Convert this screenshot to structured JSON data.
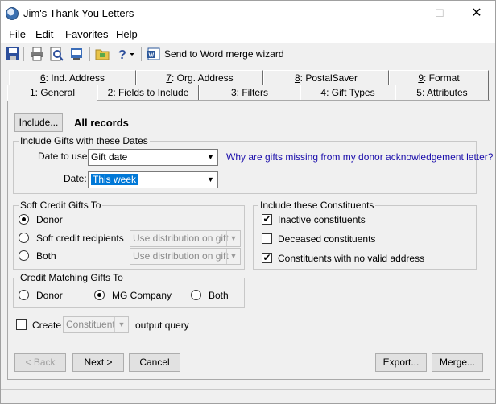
{
  "window": {
    "title": "Jim's Thank You Letters",
    "minimize": "—",
    "maximize": "☐",
    "close": "✕"
  },
  "menu": [
    "File",
    "Edit",
    "Favorites",
    "Help"
  ],
  "toolbar": {
    "wizard_label": "Send to Word merge wizard"
  },
  "tabs_back": [
    {
      "key": "6",
      "rest": ": Ind. Address"
    },
    {
      "key": "7",
      "rest": ": Org. Address"
    },
    {
      "key": "8",
      "rest": ": PostalSaver"
    },
    {
      "key": "9",
      "rest": ": Format"
    }
  ],
  "tabs_front": [
    {
      "key": "1",
      "rest": ": General"
    },
    {
      "key": "2",
      "rest": ": Fields to Include"
    },
    {
      "key": "3",
      "rest": ": Filters"
    },
    {
      "key": "4",
      "rest": ": Gift Types"
    },
    {
      "key": "5",
      "rest": ": Attributes"
    }
  ],
  "include": {
    "button": "Include...",
    "value": "All records"
  },
  "dates_group": {
    "title": "Include Gifts with these Dates",
    "date_to_use_label": "Date to use:",
    "date_to_use_value": "Gift date",
    "date_label": "Date:",
    "date_value": "This week",
    "help_link": "Why are gifts missing from my donor acknowledgement letter?"
  },
  "soft_credit": {
    "title": "Soft Credit Gifts To",
    "donor": "Donor",
    "recipients": "Soft credit recipients",
    "both": "Both",
    "distribution_1": "Use distribution on gift",
    "distribution_2": "Use distribution on gift"
  },
  "constituents": {
    "title": "Include these Constituents",
    "inactive": "Inactive constituents",
    "deceased": "Deceased constituents",
    "no_address": "Constituents with no valid address"
  },
  "matching": {
    "title": "Credit Matching Gifts To",
    "donor": "Donor",
    "mg_company": "MG Company",
    "both": "Both"
  },
  "output": {
    "create_label": "Create",
    "type": "Constituent",
    "suffix": "output query"
  },
  "footer": {
    "back": "< Back",
    "next": "Next >",
    "cancel": "Cancel",
    "export": "Export...",
    "merge": "Merge..."
  }
}
